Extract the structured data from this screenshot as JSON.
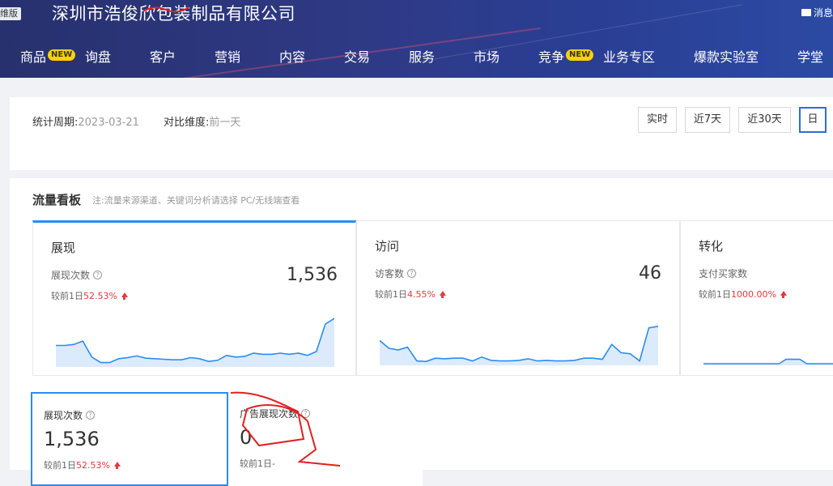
{
  "header": {
    "version_tag": "维版",
    "company": "深圳市浩俊欣包装制品有限公司",
    "message_label": "消息",
    "nav": [
      {
        "label": "商品",
        "badge": "NEW"
      },
      {
        "label": "询盘"
      },
      {
        "label": "客户"
      },
      {
        "label": "营销"
      },
      {
        "label": "内容"
      },
      {
        "label": "交易"
      },
      {
        "label": "服务"
      },
      {
        "label": "市场"
      },
      {
        "label": "竞争",
        "badge": "NEW"
      },
      {
        "label": "业务专区"
      },
      {
        "label": "爆款实验室"
      },
      {
        "label": "学堂"
      }
    ]
  },
  "period": {
    "stat_label": "统计周期:",
    "stat_value": "2023-03-21",
    "compare_label": "对比维度:",
    "compare_value": "前一天",
    "ranges": [
      {
        "label": "实时",
        "active": false
      },
      {
        "label": "近7天",
        "active": false
      },
      {
        "label": "近30天",
        "active": false
      },
      {
        "label": "日",
        "active": true
      }
    ]
  },
  "board": {
    "title": "流量看板",
    "note": "注:流量来源渠道、关键词分析请选择 PC/无线端查看",
    "cards": [
      {
        "title": "展现",
        "metric": "展现次数",
        "value": "1,536",
        "compare_prefix": "较前1日",
        "compare_value": "52.53%",
        "active": true,
        "spark": [
          0.36,
          0.36,
          0.38,
          0.44,
          0.15,
          0.05,
          0.05,
          0.12,
          0.14,
          0.17,
          0.13,
          0.12,
          0.11,
          0.1,
          0.1,
          0.14,
          0.12,
          0.07,
          0.09,
          0.18,
          0.15,
          0.16,
          0.22,
          0.2,
          0.2,
          0.22,
          0.2,
          0.22,
          0.18,
          0.25,
          0.75,
          0.85
        ]
      },
      {
        "title": "访问",
        "metric": "访客数",
        "value": "46",
        "compare_prefix": "较前1日",
        "compare_value": "4.55%",
        "active": false,
        "spark": [
          0.42,
          0.28,
          0.25,
          0.3,
          0.05,
          0.04,
          0.1,
          0.09,
          0.1,
          0.1,
          0.05,
          0.12,
          0.06,
          0.05,
          0.05,
          0.06,
          0.09,
          0.05,
          0.06,
          0.05,
          0.05,
          0.06,
          0.1,
          0.1,
          0.08,
          0.35,
          0.2,
          0.18,
          0.05,
          0.65,
          0.68
        ]
      },
      {
        "title": "转化",
        "metric": "支付买家数",
        "value": "",
        "compare_prefix": "较前1日",
        "compare_value": "1000.00%",
        "active": false,
        "spark": [
          0,
          0,
          0,
          0,
          0,
          0,
          0,
          0,
          0,
          0,
          0,
          0,
          0.08,
          0.08,
          0.08,
          0,
          0,
          0,
          0,
          0,
          0.05
        ]
      }
    ],
    "metrics": [
      {
        "label": "展现次数",
        "value": "1,536",
        "compare_prefix": "较前1日",
        "compare_value": "52.53%",
        "up": true,
        "active": true
      },
      {
        "label": "广告展现次数",
        "value": "0",
        "compare_prefix": "较前1日",
        "compare_value": "-",
        "up": false,
        "active": false
      }
    ]
  },
  "colors": {
    "accent": "#2b8cf0",
    "up": "#e4393c",
    "header": "#2f3a86"
  }
}
